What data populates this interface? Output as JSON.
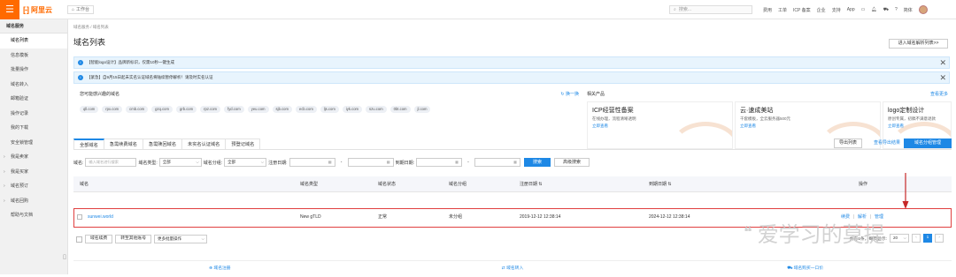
{
  "topbar": {
    "logo_mark": "[-]",
    "brand": "阿里云",
    "workspace": "工作台",
    "search_placeholder": "搜索...",
    "links": [
      "费用",
      "工单",
      "ICP 备案",
      "企业",
      "支持",
      "App"
    ],
    "lang": "简体"
  },
  "sidebar": {
    "header": "域名服务",
    "items": [
      {
        "label": "域名列表",
        "active": true,
        "expand": false
      },
      {
        "label": "信息模板",
        "active": false,
        "expand": false
      },
      {
        "label": "批量操作",
        "active": false,
        "expand": false
      },
      {
        "label": "域名转入",
        "active": false,
        "expand": false
      },
      {
        "label": "邮箱验证",
        "active": false,
        "expand": false
      },
      {
        "label": "操作记录",
        "active": false,
        "expand": false
      },
      {
        "label": "我的下载",
        "active": false,
        "expand": false
      },
      {
        "label": "安全锁管理",
        "active": false,
        "expand": false
      },
      {
        "label": "我是卖家",
        "active": false,
        "expand": true
      },
      {
        "label": "我是买家",
        "active": false,
        "expand": true
      },
      {
        "label": "域名预订",
        "active": false,
        "expand": true
      },
      {
        "label": "域名回购",
        "active": false,
        "expand": true
      },
      {
        "label": "帮助与文档",
        "active": false,
        "expand": false
      }
    ]
  },
  "breadcrumb": "域名服务 / 域名列表",
  "page_title": "域名列表",
  "entry_button": "进入域名解析列表>>",
  "notices": [
    "【智能logo设计】品牌新标识，仅需10秒一键生成",
    "【紧急】自9月15日起未实名认证域名将陆续暂停解析！请及时实名认证"
  ],
  "words": {
    "title": "您可能感兴趣的域名",
    "refresh": "换一换",
    "tags": [
      "qll.com",
      "rpx.com",
      "cmb.com",
      "gzq.com",
      "grb.com",
      "rpz.com",
      "fyd.com",
      "yeu.com",
      "sjb.com",
      "ecb.com",
      "ljs.com",
      "iyk.com",
      "szu.com",
      "0bt.com",
      "jl.com"
    ]
  },
  "products": {
    "title": "相关产品",
    "more": "查看更多",
    "cards": [
      {
        "title": "ICP经营性备案",
        "desc": "在线办理，流程清晰透明",
        "link": "立即查看"
      },
      {
        "title": "云·速成美站",
        "desc": "千套模板，全云服务器500元",
        "link": "立即查看"
      },
      {
        "title": "logo定制设计",
        "desc": "原创专属，初稿不满意退款",
        "link": "立即查看"
      }
    ]
  },
  "tabs": [
    "全部域名",
    "急需续费域名",
    "急需赎回域名",
    "未实名认证域名",
    "预登记域名"
  ],
  "actions": {
    "export": "导出列表",
    "view_export": "查看导出结果",
    "group": "域名分组管理"
  },
  "filters": {
    "domain_label": "域名:",
    "domain_placeholder": "输入域名进行搜索",
    "type_label": "域名类型:",
    "type_value": "全部",
    "group_label": "域名分组:",
    "group_value": "全部",
    "reg_label": "注册日期:",
    "exp_label": "到期日期:",
    "dash": "-",
    "search": "搜索",
    "advanced": "高级搜索"
  },
  "table": {
    "headers": [
      "域名",
      "域名类型",
      "域名状态",
      "域名分组",
      "注册日期",
      "到期日期",
      "操作"
    ],
    "sort_arrow": "⇅",
    "row": {
      "domain": "sunwei.world",
      "type": "New gTLD",
      "status": "正常",
      "group": "未分组",
      "reg": "2019-12-12 12:38:14",
      "exp": "2024-12-12 12:38:14",
      "ops": [
        "续费",
        "解析",
        "管理"
      ],
      "sep": "|"
    }
  },
  "bulk": {
    "renew": "域名续费",
    "transfer": "转至其他账号",
    "more": "更多批量操作"
  },
  "pager": {
    "total": "共有1条，每页显示:",
    "size": "20",
    "page": "1",
    "prev": "‹",
    "next": "›"
  },
  "footer": [
    "域名注册",
    "域名转入",
    "域名购买一口价"
  ],
  "watermark": "爱学习的莫提"
}
